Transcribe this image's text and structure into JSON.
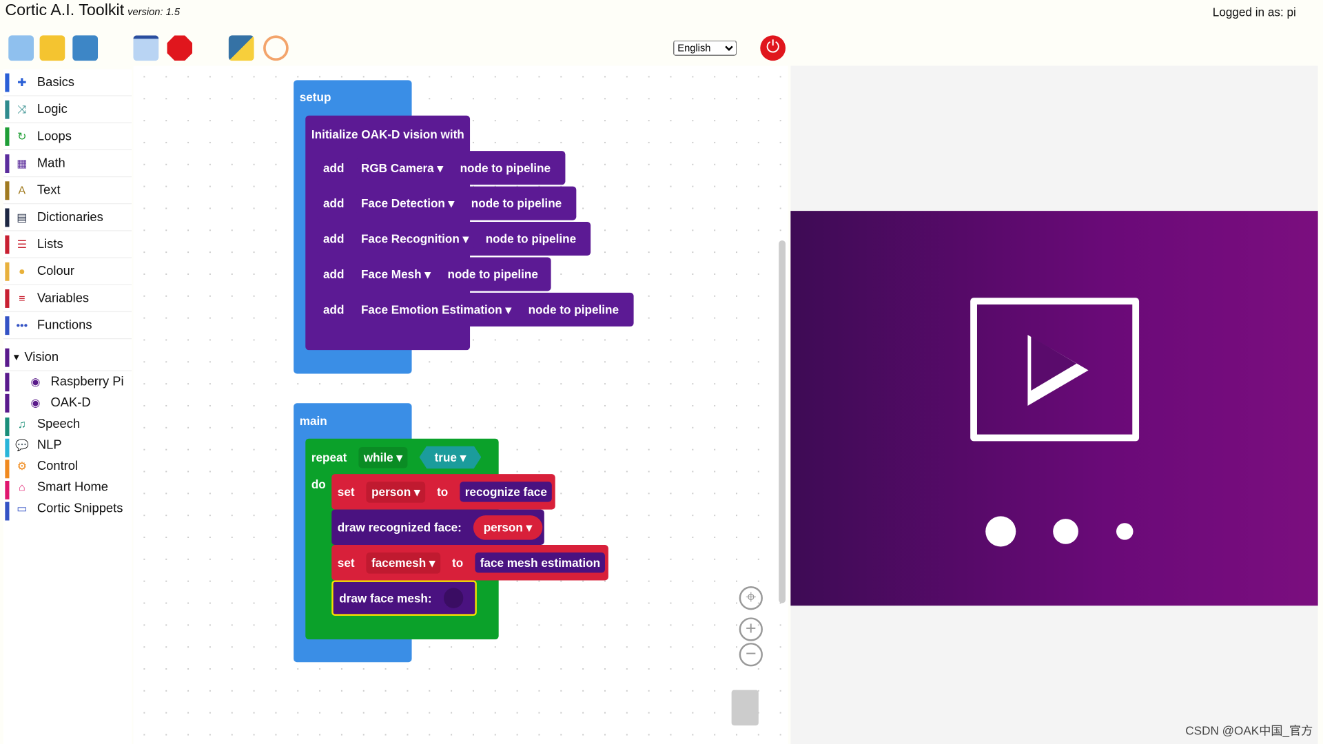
{
  "app": {
    "title": "Cortic A.I. Toolkit",
    "version": "version: 1.5",
    "login": "Logged in as: pi",
    "language": "English"
  },
  "toolbar": [
    "new-file-icon",
    "open-folder-icon",
    "save-icon",
    "run-icon",
    "stop-icon",
    "python-icon",
    "jupyter-icon",
    "power-icon"
  ],
  "sidebar": [
    {
      "label": "Basics",
      "color": "#2a5fd6",
      "icon": "✚"
    },
    {
      "label": "Logic",
      "color": "#2e8b8b",
      "icon": "⤨"
    },
    {
      "label": "Loops",
      "color": "#1f9e34",
      "icon": "↻"
    },
    {
      "label": "Math",
      "color": "#5b2d9b",
      "icon": "▦"
    },
    {
      "label": "Text",
      "color": "#a07a1e",
      "icon": "A"
    },
    {
      "label": "Dictionaries",
      "color": "#1d2740",
      "icon": "▤"
    },
    {
      "label": "Lists",
      "color": "#c8202f",
      "icon": "☰"
    },
    {
      "label": "Colour",
      "color": "#e8b13a",
      "icon": "●"
    },
    {
      "label": "Variables",
      "color": "#c8202f",
      "icon": "≡"
    },
    {
      "label": "Functions",
      "color": "#3453c4",
      "icon": "•••"
    }
  ],
  "vision": {
    "label": "Vision",
    "children": [
      "Raspberry Pi",
      "OAK-D"
    ]
  },
  "sidebar2": [
    {
      "label": "Speech",
      "color": "#1a8f77",
      "icon": "♫"
    },
    {
      "label": "NLP",
      "color": "#29b6d8",
      "icon": "💬"
    },
    {
      "label": "Control",
      "color": "#f08a1c",
      "icon": "⚙"
    },
    {
      "label": "Smart Home",
      "color": "#e0176b",
      "icon": "⌂"
    },
    {
      "label": "Cortic Snippets",
      "color": "#3453c4",
      "icon": "▭"
    }
  ],
  "blocks": {
    "setup": "setup",
    "init": "Initialize OAK-D vision with",
    "add": "add",
    "node": "node to pipeline",
    "nodes": [
      "RGB Camera ▾",
      "Face Detection ▾",
      "Face Recognition ▾",
      "Face Mesh ▾",
      "Face Emotion Estimation ▾"
    ],
    "main": "main",
    "repeat": "repeat",
    "while": "while ▾",
    "true": "true ▾",
    "do": "do",
    "set": "set",
    "person": "person ▾",
    "to": "to",
    "recognize": "recognize face",
    "draw_face": "draw recognized face:",
    "facemesh": "facemesh ▾",
    "mesh_est": "face mesh estimation",
    "draw_mesh": "draw face mesh:"
  },
  "watermark": "CSDN @OAK中国_官方"
}
